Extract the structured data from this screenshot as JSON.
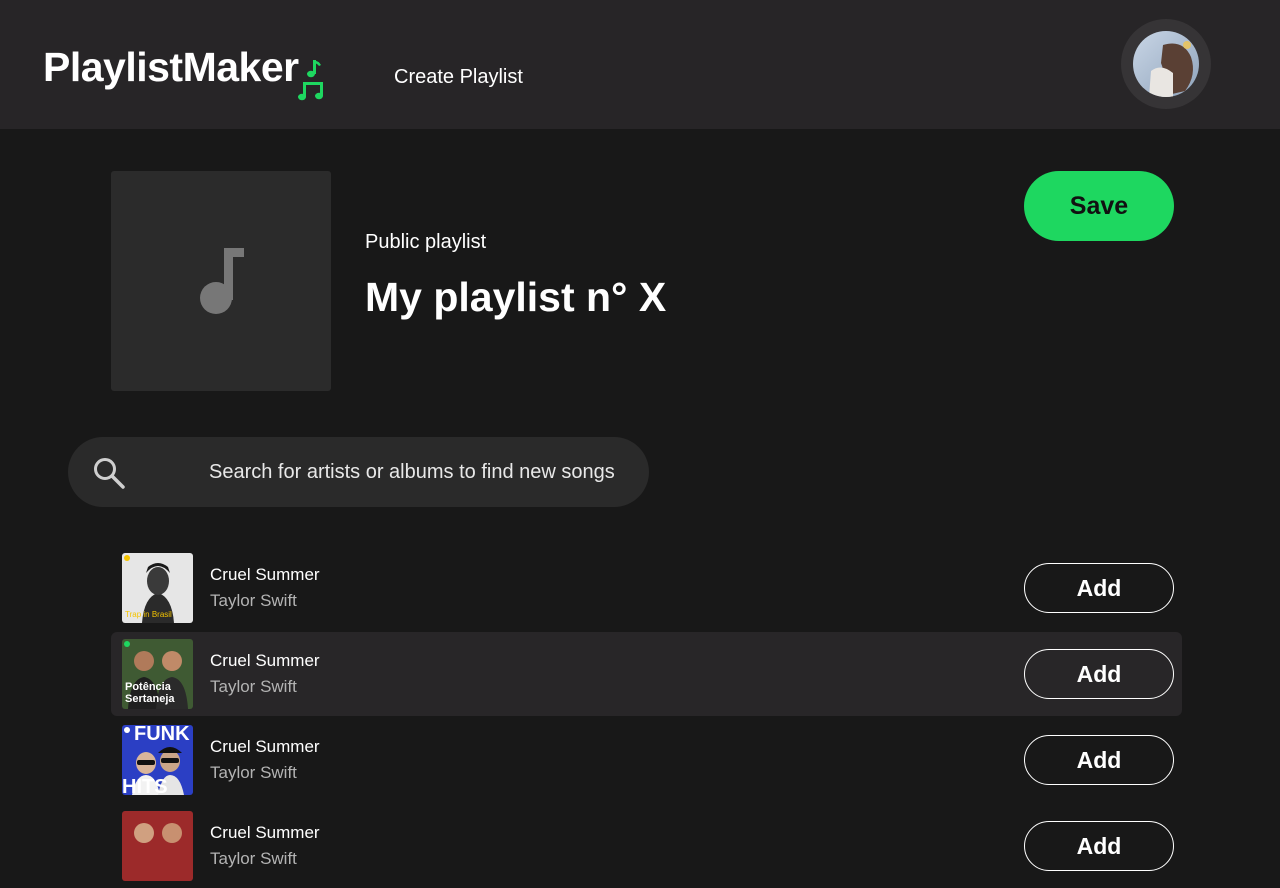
{
  "header": {
    "logo_text": "PlaylistMaker",
    "nav_create": "Create Playlist"
  },
  "playlist": {
    "type_label": "Public playlist",
    "title": "My playlist n° X",
    "save_label": "Save"
  },
  "search": {
    "placeholder": "Search for artists or albums to find new songs"
  },
  "songs": [
    {
      "title": "Cruel Summer",
      "artist": "Taylor Swift",
      "add_label": "Add",
      "cover_text": "Trap in Brasil"
    },
    {
      "title": "Cruel Summer",
      "artist": "Taylor Swift",
      "add_label": "Add",
      "cover_text_1": "Potência",
      "cover_text_2": "Sertaneja"
    },
    {
      "title": "Cruel Summer",
      "artist": "Taylor Swift",
      "add_label": "Add",
      "cover_text_1": "FUNK",
      "cover_text_2": "HITS"
    },
    {
      "title": "Cruel Summer",
      "artist": "Taylor Swift",
      "add_label": "Add"
    }
  ],
  "colors": {
    "accent": "#1ed760",
    "background": "#181818",
    "topbar": "#272527",
    "highlight_row": "#282628"
  }
}
